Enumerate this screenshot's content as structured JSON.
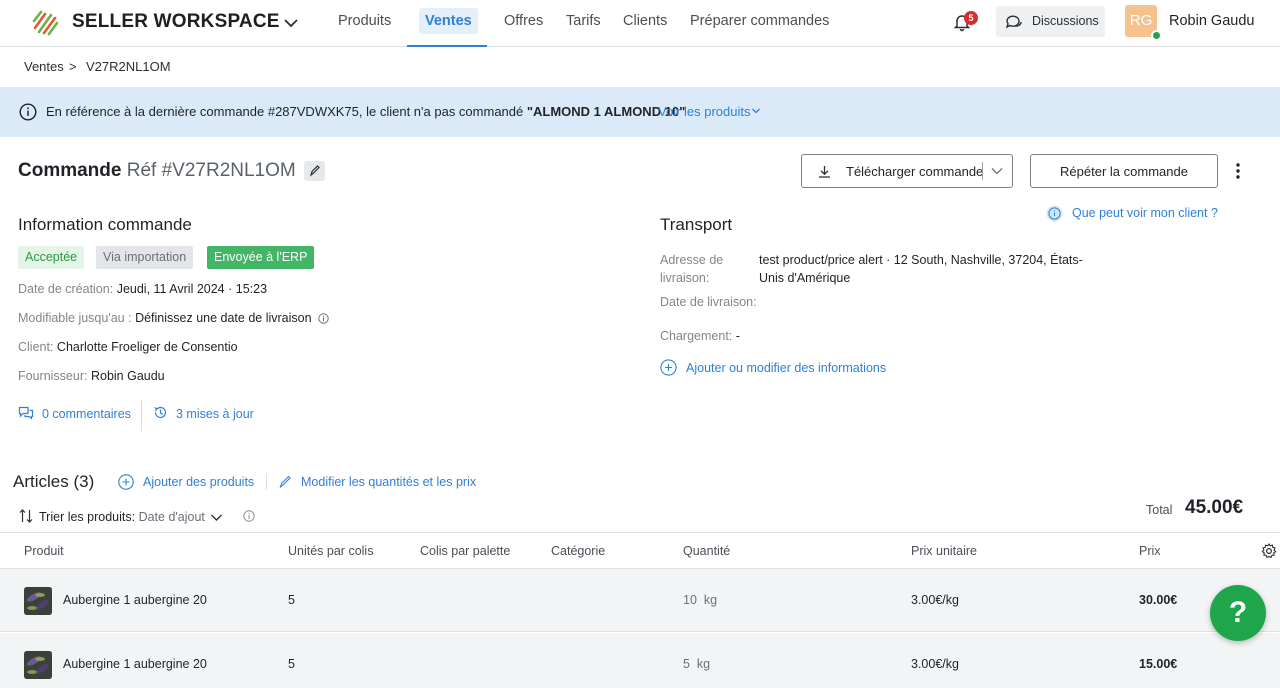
{
  "brand": {
    "name": "SELLER WORKSPACE"
  },
  "nav": [
    {
      "label": "Produits"
    },
    {
      "label": "Ventes"
    },
    {
      "label": "Offres"
    },
    {
      "label": "Tarifs"
    },
    {
      "label": "Clients"
    },
    {
      "label": "Préparer commandes"
    }
  ],
  "header_right": {
    "notif_count": "5",
    "discussions_label": "Discussions",
    "avatar_initials": "RG",
    "user_name": "Robin Gaudu"
  },
  "breadcrumb": {
    "parent": "Ventes",
    "sep": ">",
    "current": "V27R2NL1OM"
  },
  "banner": {
    "text_before": "En référence à la dernière commande #287VDWXK75, le client n'a pas commandé ",
    "product": "\"ALMOND 1 ALMOND 10\"",
    "link": "Voir les produits"
  },
  "order": {
    "title": "Commande",
    "ref": "Réf #V27R2NL1OM",
    "download_label": "Télécharger commande",
    "repeat_label": "Répéter la commande"
  },
  "info": {
    "heading": "Information commande",
    "tags": {
      "accepted": "Acceptée",
      "import": "Via importation",
      "erp": "Envoyée à l'ERP"
    },
    "created_k": "Date de création:",
    "created_v": "Jeudi, 11 Avril 2024 · 15:23",
    "editable_k": "Modifiable jusqu'au :",
    "editable_v": "Définissez une date de livraison",
    "client_k": "Client:",
    "client_v": "Charlotte Froeliger de Consentio",
    "supplier_k": "Fournisseur:",
    "supplier_v": "Robin Gaudu",
    "comments": "0 commentaires",
    "updates": "3 mises à jour"
  },
  "transport": {
    "heading": "Transport",
    "client_view_link": "Que peut voir mon client ?",
    "address_k": "Adresse de livraison:",
    "address_v": "test product/price alert · 12 South, Nashville, 37204, États-Unis d'Amérique",
    "delivery_k": "Date de livraison:",
    "loading_k": "Chargement:",
    "loading_v": "-",
    "add_link": "Ajouter ou modifier des informations"
  },
  "articles": {
    "heading": "Articles (3)",
    "add_products": "Ajouter des produits",
    "edit_qty": "Modifier les quantités et les prix",
    "sort_label": "Trier les produits:",
    "sort_value": "Date d'ajout",
    "total_label": "Total",
    "total_value": "45.00€"
  },
  "table": {
    "headers": [
      "Produit",
      "Unités par colis",
      "Colis par palette",
      "Catégorie",
      "Quantité",
      "Prix unitaire",
      "Prix"
    ],
    "rows": [
      {
        "product": "Aubergine 1 aubergine 20",
        "units": "5",
        "qty": "10",
        "unit": "kg",
        "unit_price": "3.00€/kg",
        "price": "30.00€"
      },
      {
        "product": "Aubergine 1 aubergine 20",
        "units": "5",
        "qty": "5",
        "unit": "kg",
        "unit_price": "3.00€/kg",
        "price": "15.00€"
      }
    ]
  },
  "help_label": "?",
  "colors": {
    "accent": "#2f80d8",
    "success": "#43b566",
    "banner": "#dbeaf9",
    "alert": "#d32f2f"
  }
}
